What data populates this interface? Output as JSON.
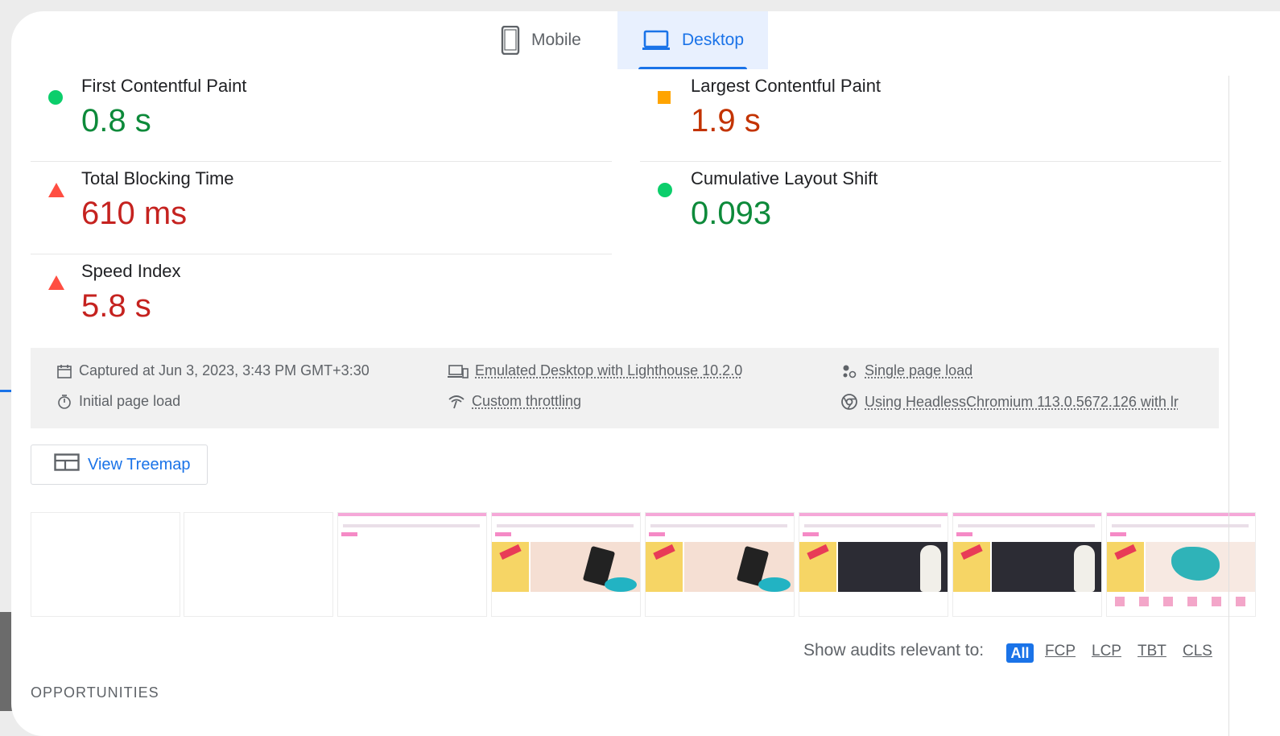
{
  "tabs": {
    "mobile": {
      "label": "Mobile",
      "icon": "mobile-phone-icon"
    },
    "desktop": {
      "label": "Desktop",
      "icon": "laptop-icon",
      "selected": true
    }
  },
  "metrics": [
    {
      "label": "First Contentful Paint",
      "value": "0.8 s",
      "status": "pass",
      "marker": "green-circle"
    },
    {
      "label": "Largest Contentful Paint",
      "value": "1.9 s",
      "status": "average",
      "marker": "orange-square"
    },
    {
      "label": "Total Blocking Time",
      "value": "610 ms",
      "status": "fail",
      "marker": "red-triangle"
    },
    {
      "label": "Cumulative Layout Shift",
      "value": "0.093",
      "status": "pass",
      "marker": "green-circle"
    },
    {
      "label": "Speed Index",
      "value": "5.8 s",
      "status": "fail",
      "marker": "red-triangle"
    }
  ],
  "runtime_info": {
    "captured": "Captured at Jun 3, 2023, 3:43 PM GMT+3:30",
    "page_load": "Initial page load",
    "emulation": "Emulated Desktop with Lighthouse 10.2.0",
    "throttling": "Custom throttling",
    "session": "Single page load",
    "browser": "Using HeadlessChromium 113.0.5672.126 with lr"
  },
  "treemap_button": {
    "label": "View Treemap",
    "icon": "treemap-icon"
  },
  "filmstrip": {
    "frames": [
      "blank",
      "blank",
      "header-only",
      "hero-product",
      "hero-product",
      "hero-dark",
      "hero-dark",
      "hero-map"
    ]
  },
  "audit_filter": {
    "label": "Show audits relevant to:",
    "options": [
      "All",
      "FCP",
      "LCP",
      "TBT",
      "CLS"
    ],
    "selected": "All"
  },
  "section": {
    "title": "OPPORTUNITIES"
  },
  "colors": {
    "pass": "#0cce6b",
    "average": "#ffa400",
    "fail": "#ff4e42",
    "accent": "#1a73e8"
  }
}
